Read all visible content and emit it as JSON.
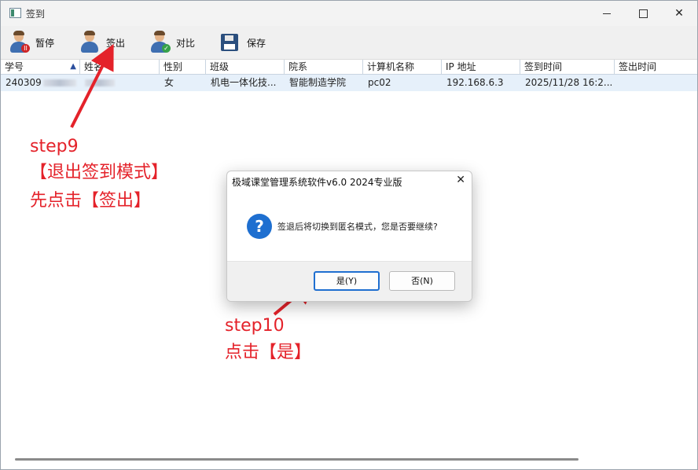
{
  "window": {
    "title": "签到"
  },
  "toolbar": {
    "pause_label": "暂停",
    "signout_label": "签出",
    "compare_label": "对比",
    "save_label": "保存"
  },
  "table": {
    "columns": [
      "学号",
      "姓名",
      "性别",
      "班级",
      "院系",
      "计算机名称",
      "IP 地址",
      "签到时间",
      "签出时间"
    ],
    "rows": [
      {
        "student_id": "240309",
        "name": "",
        "gender": "女",
        "class": "机电一体化技...",
        "department": "智能制造学院",
        "computer": "pc02",
        "ip": "192.168.6.3",
        "signin_time": "2025/11/28 16:2...",
        "signout_time": ""
      }
    ]
  },
  "annotations": {
    "step9_title": "step9",
    "step9_line1": "【退出签到模式】",
    "step9_line2": "先点击【签出】",
    "step10_title": "step10",
    "step10_line1": "点击【是】"
  },
  "dialog": {
    "title": "极域课堂管理系统软件v6.0 2024专业版",
    "message": "签退后将切换到匿名模式，您是否要继续?",
    "yes_label": "是(Y)",
    "no_label": "否(N)"
  },
  "colors": {
    "annotation": "#e4222a",
    "selection": "#e6f0fa",
    "accent": "#1f6fd0"
  }
}
